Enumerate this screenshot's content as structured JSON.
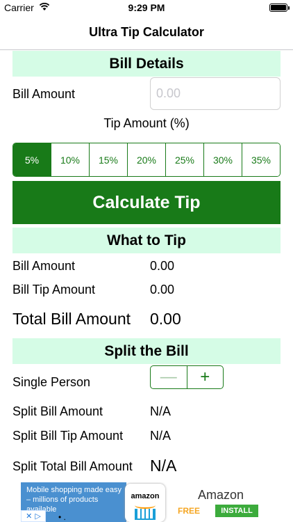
{
  "status_bar": {
    "carrier": "Carrier",
    "time": "9:29 PM"
  },
  "nav": {
    "title": "Ultra Tip Calculator"
  },
  "bill_details": {
    "header": "Bill Details",
    "bill_amount_label": "Bill Amount",
    "bill_amount_value": "",
    "bill_amount_placeholder": "0.00",
    "tip_caption": "Tip Amount (%)",
    "tip_options": [
      "5%",
      "10%",
      "15%",
      "20%",
      "25%",
      "30%",
      "35%"
    ],
    "selected_tip": "5%"
  },
  "calculate_button": "Calculate Tip",
  "what_to_tip": {
    "header": "What to Tip",
    "rows": [
      {
        "label": "Bill Amount",
        "value": "0.00"
      },
      {
        "label": "Bill Tip Amount",
        "value": "0.00"
      },
      {
        "label": "Total Bill Amount",
        "value": "0.00"
      }
    ]
  },
  "split": {
    "header": "Split the Bill",
    "people_label": "Single Person",
    "stepper_minus": "—",
    "stepper_plus": "+",
    "rows": [
      {
        "label": "Split Bill Amount",
        "value": "N/A"
      },
      {
        "label": "Split Bill Tip Amount",
        "value": "N/A"
      },
      {
        "label": "Split Total Bill Amount",
        "value": "N/A"
      }
    ]
  },
  "ad": {
    "text": "Mobile shopping made easy – millions of products available",
    "logo_text": "amazon",
    "brand": "Amazon",
    "price": "FREE",
    "install_label": "INSTALL"
  },
  "colors": {
    "accent_green": "#187a18",
    "header_mint": "#d5fce6"
  },
  "icons": {
    "status": [
      "wifi-icon",
      "battery-icon"
    ],
    "ad": [
      "adchoices-icon",
      "close-icon"
    ]
  }
}
